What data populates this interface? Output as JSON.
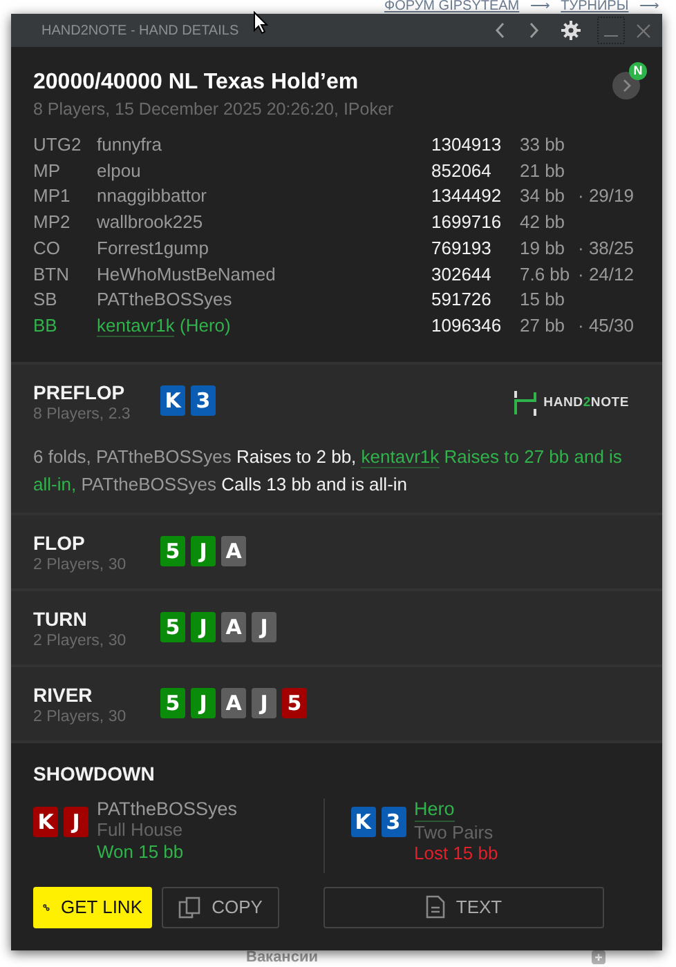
{
  "background": {
    "breadcrumb": [
      "ФОРУМ GIPSYTEAM",
      "⟶",
      "ТУРНИРЫ",
      "⟶"
    ],
    "footer_link": "Вакансии"
  },
  "window": {
    "title": "HAND2NOTE - HAND DETAILS"
  },
  "header": {
    "title": "20000/40000 NL Texas Hold’em",
    "subtitle": "8 Players, 15 December 2025 20:26:20, IPoker",
    "badge": "N"
  },
  "players": [
    {
      "position": "UTG2",
      "name": "funnyfra",
      "stack": "1304913",
      "bb": "33 bb",
      "hero": false
    },
    {
      "position": "MP",
      "name": "elpou",
      "stack": "852064",
      "bb": "21 bb",
      "hero": false
    },
    {
      "position": "MP1",
      "name": "nnaggibbattor",
      "stack": "1344492",
      "bb": "34 bb",
      "stats": "· 29/19",
      "hero": false
    },
    {
      "position": "MP2",
      "name": "wallbrook225",
      "stack": "1699716",
      "bb": "42 bb",
      "hero": false
    },
    {
      "position": "CO",
      "name": "Forrest1gump",
      "stack": "769193",
      "bb": "19 bb",
      "stats": "· 38/25",
      "hero": false
    },
    {
      "position": "BTN",
      "name": "HeWhoMustBeNamed",
      "stack": "302644",
      "bb": "7.6 bb",
      "stats": "· 24/12",
      "hero": false
    },
    {
      "position": "SB",
      "name": "PATtheBOSSyes",
      "stack": "591726",
      "bb": "15 bb",
      "hero": false
    },
    {
      "position": "BB",
      "name": "kentavr1k",
      "name_suffix": "(Hero)",
      "stack": "1096346",
      "bb": "27 bb",
      "stats": "· 45/30",
      "hero": true
    }
  ],
  "logo": {
    "before": "HAND",
    "accent": "2",
    "after": "NOTE"
  },
  "streets": [
    {
      "name": "PREFLOP",
      "info": "8 Players, 2.3",
      "cards": [
        {
          "rank": "K",
          "color": "#0b5db3"
        },
        {
          "rank": "3",
          "color": "#0b5db3"
        }
      ],
      "actions": [
        {
          "text": "6 folds,",
          "kind": "plain"
        },
        {
          "text": "PATtheBOSSyes",
          "kind": "player"
        },
        {
          "text": "Raises to 2 bb,",
          "kind": "action"
        },
        {
          "text": "kentavr1k",
          "kind": "hero_player"
        },
        {
          "text": "Raises to 27 bb and is all-in,",
          "kind": "hero_action"
        },
        {
          "text": "PATtheBOSSyes",
          "kind": "player"
        },
        {
          "text": "Calls 13 bb and is all-in",
          "kind": "action"
        }
      ]
    },
    {
      "name": "FLOP",
      "info": "2 Players, 30",
      "cards": [
        {
          "rank": "5",
          "color": "#0a8c0a"
        },
        {
          "rank": "J",
          "color": "#0a8c0a"
        },
        {
          "rank": "A",
          "color": "#5e5e5e"
        }
      ]
    },
    {
      "name": "TURN",
      "info": "2 Players, 30",
      "cards": [
        {
          "rank": "5",
          "color": "#0a8c0a"
        },
        {
          "rank": "J",
          "color": "#0a8c0a"
        },
        {
          "rank": "A",
          "color": "#5e5e5e"
        },
        {
          "rank": "J",
          "color": "#5e5e5e"
        }
      ]
    },
    {
      "name": "RIVER",
      "info": "2 Players, 30",
      "cards": [
        {
          "rank": "5",
          "color": "#0a8c0a"
        },
        {
          "rank": "J",
          "color": "#0a8c0a"
        },
        {
          "rank": "A",
          "color": "#5e5e5e"
        },
        {
          "rank": "J",
          "color": "#5e5e5e"
        },
        {
          "rank": "5",
          "color": "#a30000"
        }
      ]
    }
  ],
  "showdown": {
    "title": "SHOWDOWN",
    "sides": [
      {
        "cards": [
          {
            "rank": "K",
            "color": "#a30000"
          },
          {
            "rank": "J",
            "color": "#a30000"
          }
        ],
        "name": "PATtheBOSSyes",
        "hand": "Full House",
        "result": "Won 15 bb",
        "color": "#2fb34a",
        "hero": false
      },
      {
        "cards": [
          {
            "rank": "K",
            "color": "#0b5db3"
          },
          {
            "rank": "3",
            "color": "#0b5db3"
          }
        ],
        "name": "Hero",
        "hand": "Two Pairs",
        "result": "Lost 15 bb",
        "color": "#e0202a",
        "hero": true
      }
    ]
  },
  "buttons": [
    {
      "label": "GET LINK",
      "kind": "link"
    },
    {
      "label": "COPY",
      "kind": "copy"
    },
    {
      "label": "TEXT",
      "kind": "text"
    }
  ]
}
